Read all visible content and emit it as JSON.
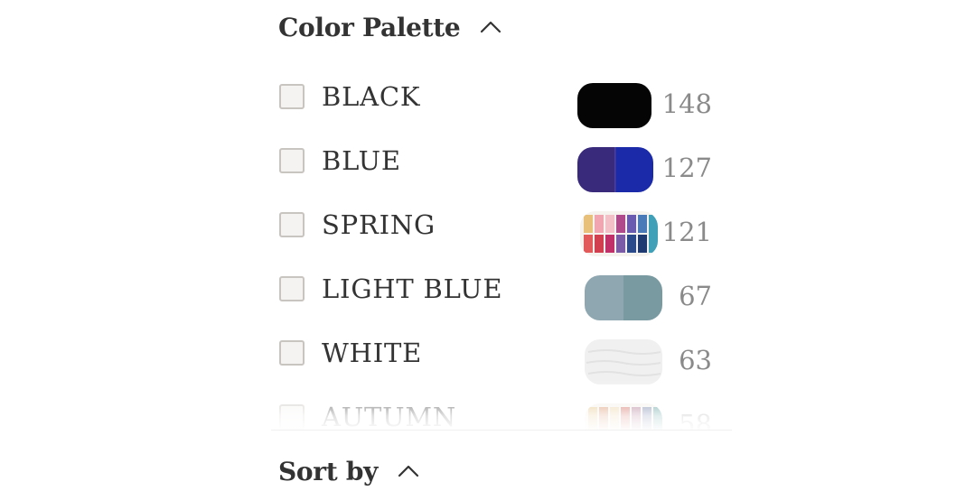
{
  "filter": {
    "title": "Color Palette",
    "options": [
      {
        "label": "BLACK",
        "count": "148",
        "swatch_colors": [
          "#050505",
          "#0a0a0a"
        ]
      },
      {
        "label": "BLUE",
        "count": "127",
        "swatch_colors": [
          "#3a2a7c",
          "#1b2aa8"
        ]
      },
      {
        "label": "SPRING",
        "count": "121",
        "swatch_colors": [
          "#e8c07a",
          "#e25a5a",
          "#f0a5b0",
          "#c2306a",
          "#7b5aa8",
          "#2a4a8c",
          "#3fa0b8"
        ]
      },
      {
        "label": "LIGHT BLUE",
        "count": "67",
        "swatch_colors": [
          "#8fa7b0",
          "#7a9aa2"
        ]
      },
      {
        "label": "WHITE",
        "count": "63",
        "swatch_colors": [
          "#f2f2f2",
          "#e8e8e8"
        ]
      },
      {
        "label": "AUTUMN",
        "count": "58",
        "swatch_colors": [
          "#e0b870",
          "#d27a4a",
          "#c84a3a",
          "#a05a7a",
          "#5a6a9a",
          "#3a8a8a",
          "#6aaab0"
        ]
      }
    ]
  },
  "sort": {
    "title": "Sort by"
  },
  "icons": {
    "collapse": "chevron-up-icon"
  }
}
